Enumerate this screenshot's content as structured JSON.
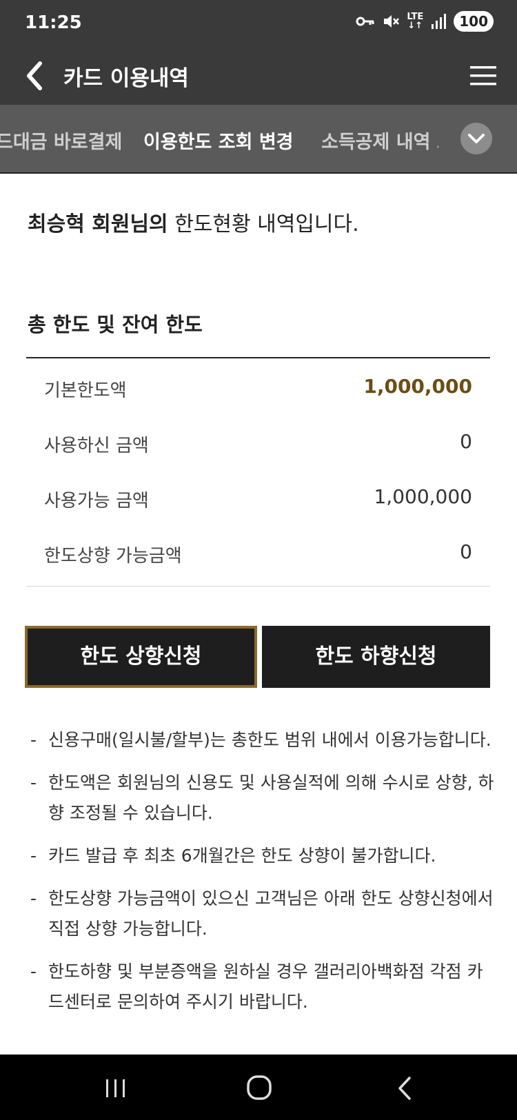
{
  "status": {
    "time": "11:25",
    "network": "LTE",
    "battery": "100"
  },
  "appbar": {
    "title": "카드 이용내역"
  },
  "tabs": {
    "prev_label": "드대금 바로결제",
    "active_label": "이용한도 조회 변경",
    "next_label": "소득공제 내역 조"
  },
  "intro": {
    "name": "최승혁 회원님의",
    "text": " 한도현황 내역입니다."
  },
  "section": {
    "title": "총 한도 및 잔여 한도"
  },
  "limits": [
    {
      "label": "기본한도액",
      "value": "1,000,000"
    },
    {
      "label": "사용하신 금액",
      "value": "0"
    },
    {
      "label": "사용가능 금액",
      "value": "1,000,000"
    },
    {
      "label": "한도상향 가능금액",
      "value": "0"
    }
  ],
  "buttons": {
    "increase": "한도 상향신청",
    "decrease": "한도 하향신청"
  },
  "notes": [
    {
      "dash": "-",
      "text": "신용구매(일시불/할부)는 총한도 범위 내에서 이용가능합니다."
    },
    {
      "dash": "-",
      "text": "한도액은 회원님의 신용도 및 사용실적에 의해 수시로 상향, 하향 조정될 수 있습니다."
    },
    {
      "dash": "-",
      "text": "카드 발급 후 최초 6개월간은 한도 상향이 불가합니다."
    },
    {
      "dash": "-",
      "text": "한도상향 가능금액이 있으신 고객님은 아래 한도 상향신청에서 직접 상향 가능합니다."
    },
    {
      "dash": "-",
      "text": "한도하향 및 부분증액을 원하실 경우 갤러리아백화점 각점 카드센터로 문의하여 주시기 바랍니다."
    }
  ],
  "colors": {
    "accent_gold": "#6b4e16",
    "button_border": "#8a6a2a",
    "header_bg": "#3a3a3a"
  },
  "icons": [
    "key-icon",
    "mute-icon",
    "signal-icon",
    "back-arrow-icon",
    "hamburger-menu-icon",
    "chevron-down-icon",
    "recents-icon",
    "home-icon",
    "nav-back-icon"
  ]
}
